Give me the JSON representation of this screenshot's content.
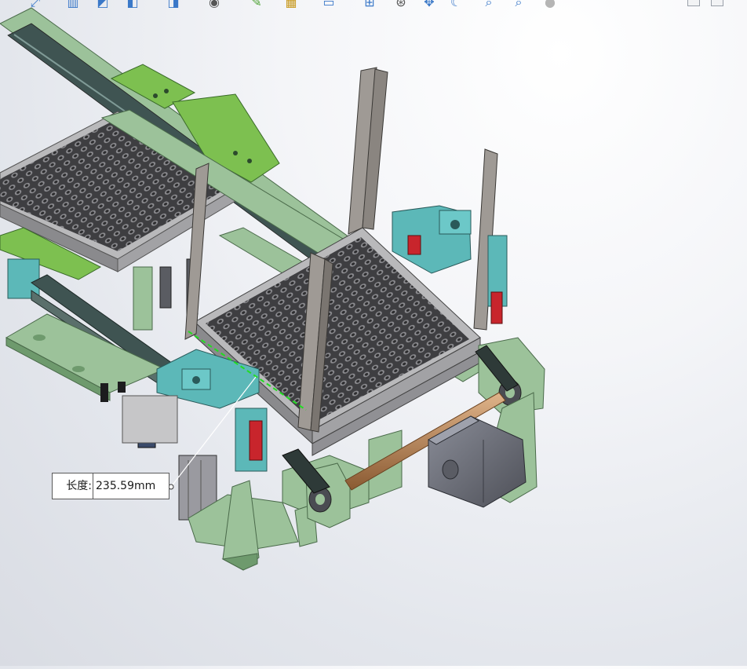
{
  "colors": {
    "frame_green": "#9cc29a",
    "frame_green_dark": "#6e9a6d",
    "bracket_green": "#7dc050",
    "plate_gray": "#b9b9bb",
    "tray_dark": "#4a4a4d",
    "cyan_part": "#5cb8b8",
    "red_part": "#c8252c",
    "motor_gray": "#6b6e78",
    "shaft_copper": "#c08a5a",
    "rail_dark": "#4a5a58",
    "measure_green": "#22dd22"
  },
  "toolbar": {
    "icons": [
      "zoom-to-fit-icon",
      "section-view-icon",
      "view-orientation-icon",
      "display-style-icon",
      "hide-show-icon",
      "edit-appearance-icon",
      "apply-scene-icon",
      "render-icon",
      "view-settings-icon",
      "display-pane-icon",
      "move-view-icon",
      "rotate-view-icon",
      "zoom-area-icon",
      "zoom-in-out-icon",
      "help-icon"
    ]
  },
  "measurement": {
    "label": "长度:",
    "value": "235.59mm"
  }
}
